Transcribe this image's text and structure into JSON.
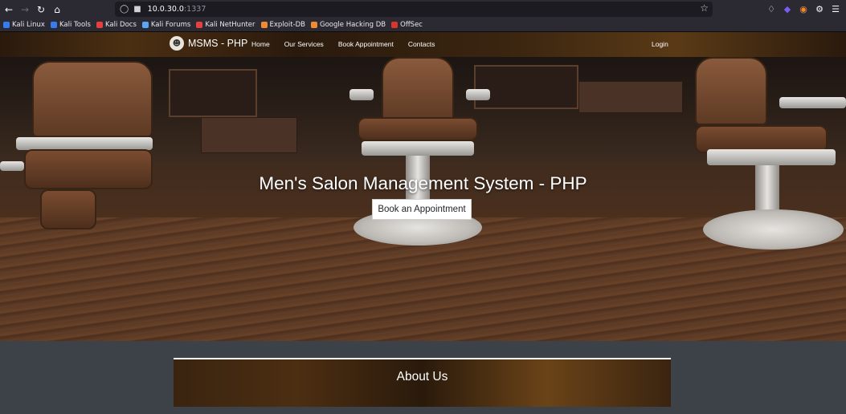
{
  "browser": {
    "url_host": "10.0.30.0",
    "url_port": ":1337",
    "bookmarks": [
      {
        "label": "Kali Linux",
        "color": "#367bf0"
      },
      {
        "label": "Kali Tools",
        "color": "#367bf0"
      },
      {
        "label": "Kali Docs",
        "color": "#e63f3f"
      },
      {
        "label": "Kali Forums",
        "color": "#5ca4f6"
      },
      {
        "label": "Kali NetHunter",
        "color": "#e63f3f"
      },
      {
        "label": "Exploit-DB",
        "color": "#f08a30"
      },
      {
        "label": "Google Hacking DB",
        "color": "#f08a30"
      },
      {
        "label": "OffSec",
        "color": "#d9352c"
      }
    ]
  },
  "navbar": {
    "brand": "MSMS - PHP",
    "links": [
      "Home",
      "Our Services",
      "Book Appointment",
      "Contacts"
    ],
    "login": "Login"
  },
  "hero": {
    "title": "Men's Salon Management System - PHP",
    "button": "Book an Appointment"
  },
  "about": {
    "title": "About Us"
  }
}
